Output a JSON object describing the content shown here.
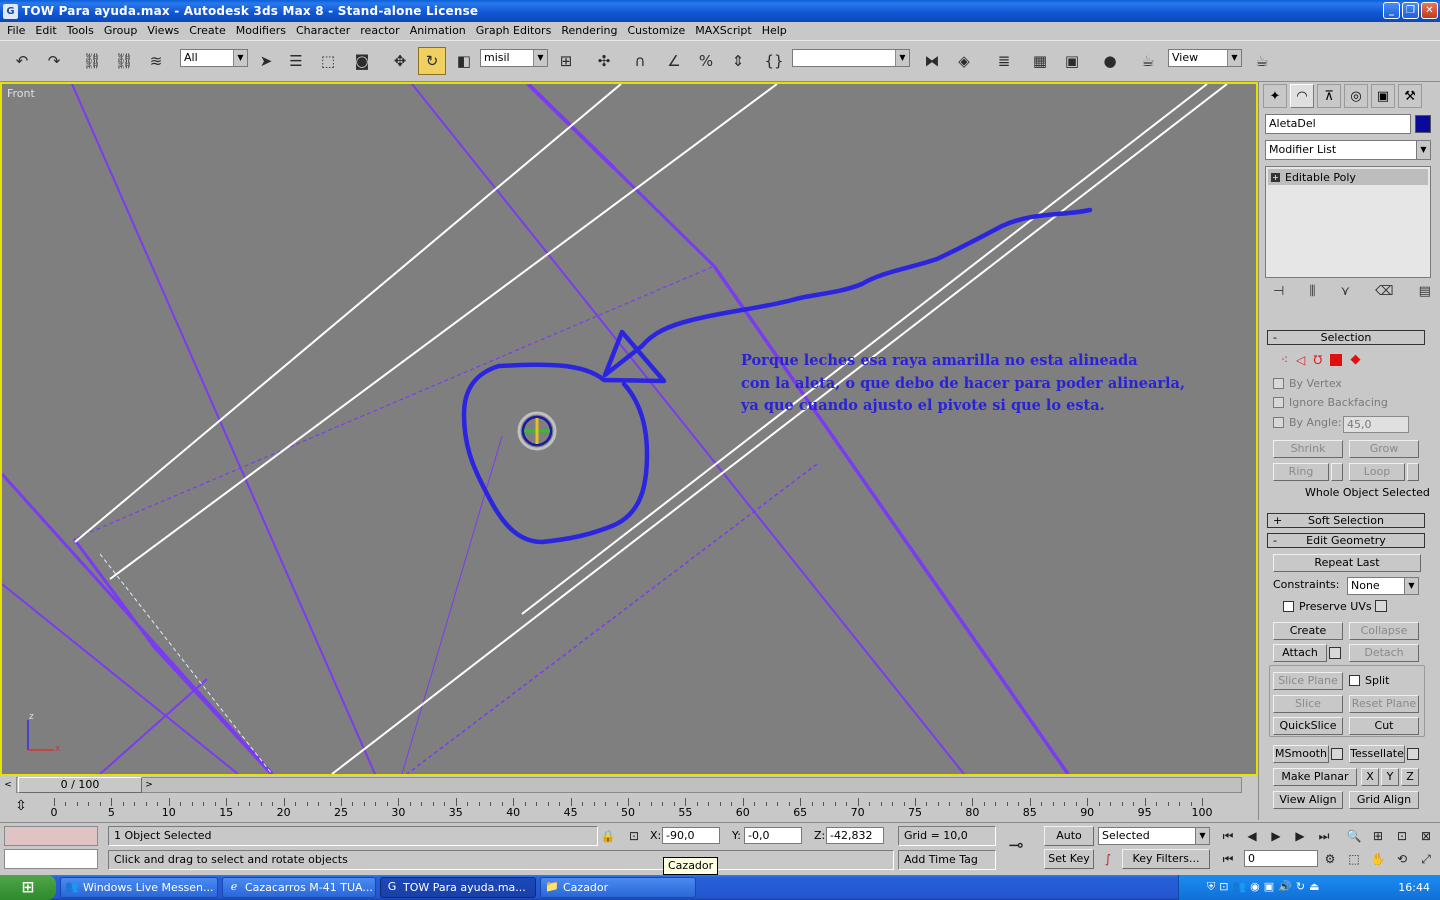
{
  "window": {
    "title": "TOW Para ayuda.max - Autodesk 3ds Max 8 - Stand-alone License",
    "minimize": "_",
    "maximize": "❐",
    "close": "✕"
  },
  "menu": [
    "File",
    "Edit",
    "Tools",
    "Group",
    "Views",
    "Create",
    "Modifiers",
    "Character",
    "reactor",
    "Animation",
    "Graph Editors",
    "Rendering",
    "Customize",
    "MAXScript",
    "Help"
  ],
  "toolbar": {
    "selection_filter": "All",
    "reference_coord": "misil",
    "named_selection": "",
    "render_dropdown": "View"
  },
  "viewport": {
    "label": "Front",
    "annotation_lines": [
      "Porque leches esa raya amarilla no esta alineada",
      "con la aleta, o que debo de hacer para poder alinearla,",
      "ya que cuando ajusto el pivote si que lo esta."
    ],
    "axis_z": "z",
    "axis_x": "x"
  },
  "command_panel": {
    "object_name": "AletaDel",
    "object_color": "#0a0a9a",
    "modifier_list": "Modifier List",
    "stack_items": [
      "Editable Poly"
    ],
    "selection": {
      "title": "Selection",
      "by_vertex": "By Vertex",
      "ignore_backfacing": "Ignore Backfacing",
      "by_angle": "By Angle:",
      "angle_value": "45,0",
      "shrink": "Shrink",
      "grow": "Grow",
      "ring": "Ring",
      "loop": "Loop",
      "status": "Whole Object Selected"
    },
    "soft_selection": "Soft Selection",
    "edit_geometry": {
      "title": "Edit Geometry",
      "repeat_last": "Repeat Last",
      "constraints_label": "Constraints:",
      "constraints_value": "None",
      "preserve_uvs": "Preserve UVs",
      "create": "Create",
      "collapse": "Collapse",
      "attach": "Attach",
      "detach": "Detach",
      "slice_plane": "Slice Plane",
      "split": "Split",
      "slice": "Slice",
      "reset_plane": "Reset Plane",
      "quickslice": "QuickSlice",
      "cut": "Cut",
      "msmooth": "MSmooth",
      "tessellate": "Tessellate",
      "make_planar": "Make Planar",
      "x": "X",
      "y": "Y",
      "z": "Z",
      "view_align": "View Align",
      "grid_align": "Grid Align"
    }
  },
  "timeline": {
    "frame_display": "0 / 100",
    "ruler_numbers": [
      "0",
      "5",
      "10",
      "15",
      "20",
      "25",
      "30",
      "35",
      "40",
      "45",
      "50",
      "55",
      "60",
      "65",
      "70",
      "75",
      "80",
      "85",
      "90",
      "95",
      "100"
    ]
  },
  "status": {
    "selection_count": "1 Object Selected",
    "prompt": "Click and drag to select and rotate objects",
    "x_label": "X:",
    "x_value": "-90,0",
    "y_label": "Y:",
    "y_value": "-0,0",
    "z_label": "Z:",
    "z_value": "-42,832",
    "grid": "Grid = 10,0",
    "add_time_tag": "Add Time Tag",
    "auto_key": "Auto Key",
    "set_key": "Set Key",
    "key_mode": "Selected",
    "key_filters": "Key Filters...",
    "current_frame": "0",
    "tooltip": "Cazador"
  },
  "taskbar": {
    "tasks": [
      {
        "label": "Windows Live Messen...",
        "active": false
      },
      {
        "label": "Cazacarros M-41 TUA...",
        "active": false
      },
      {
        "label": "TOW Para ayuda.ma...",
        "active": true
      },
      {
        "label": "Cazador",
        "active": false
      }
    ],
    "clock": "16:44"
  }
}
